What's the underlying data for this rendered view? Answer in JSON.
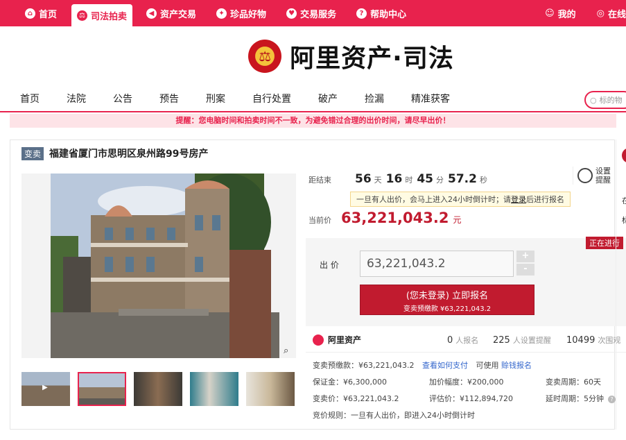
{
  "topnav": {
    "items": [
      "首页",
      "司法拍卖",
      "资产交易",
      "珍品好物",
      "交易服务",
      "帮助中心"
    ],
    "active_index": 1,
    "my": "我的",
    "online": "在线"
  },
  "logo": {
    "text": "阿里资产·司法"
  },
  "mainnav": {
    "items": [
      "首页",
      "法院",
      "公告",
      "预告",
      "刑案",
      "自行处置",
      "破产",
      "捡漏",
      "精准获客"
    ],
    "search_placeholder": "标的物"
  },
  "notice": "提醒：您电脑时间和拍卖时间不一致，为避免错过合理的出价时间，请尽早出价！",
  "item": {
    "badge": "变卖",
    "title": "福建省厦门市思明区泉州路99号房产"
  },
  "countdown": {
    "label": "距结束",
    "days": "56",
    "days_unit": "天",
    "hours": "16",
    "hours_unit": "时",
    "minutes": "45",
    "minutes_unit": "分",
    "seconds": "57.2",
    "seconds_unit": "秒"
  },
  "remind": {
    "line1": "设置",
    "line2": "提醒"
  },
  "tip": {
    "before": "一旦有人出价，会马上进入24小时倒计时；请",
    "login": "登录",
    "after": "后进行报名"
  },
  "current_price": {
    "label": "当前价",
    "value": "63,221,043.2",
    "unit": "元"
  },
  "status": "正在进行",
  "bid": {
    "label": "出 价",
    "value": "63,221,043.2",
    "plus": "+",
    "minus": "-",
    "button_line1": "(您未登录) 立即报名",
    "button_line2": "变卖预缴款 ¥63,221,043.2"
  },
  "stats": {
    "brand": "阿里资产",
    "signups": "0",
    "signups_label": "人报名",
    "reminders": "225",
    "reminders_label": "人设置提醒",
    "views": "10499",
    "views_label": "次围观"
  },
  "details": {
    "prepay": "变卖预缴款：¥63,221,043.2",
    "how_to_pay": "查看如何支付",
    "loan_prefix": "可使用",
    "loan_link": "赊钱报名",
    "deposit": "保证金：¥6,300,000",
    "increment": "加价幅度：¥200,000",
    "period": "变卖周期：60天",
    "sale_price": "变卖价：¥63,221,043.2",
    "appraisal": "评估价：¥112,894,720",
    "delay": "延时周期：5分钟",
    "rule": "竞价规则：一旦有人出价，即进入24小时倒计时"
  },
  "right_partial": [
    "在",
    "标"
  ]
}
